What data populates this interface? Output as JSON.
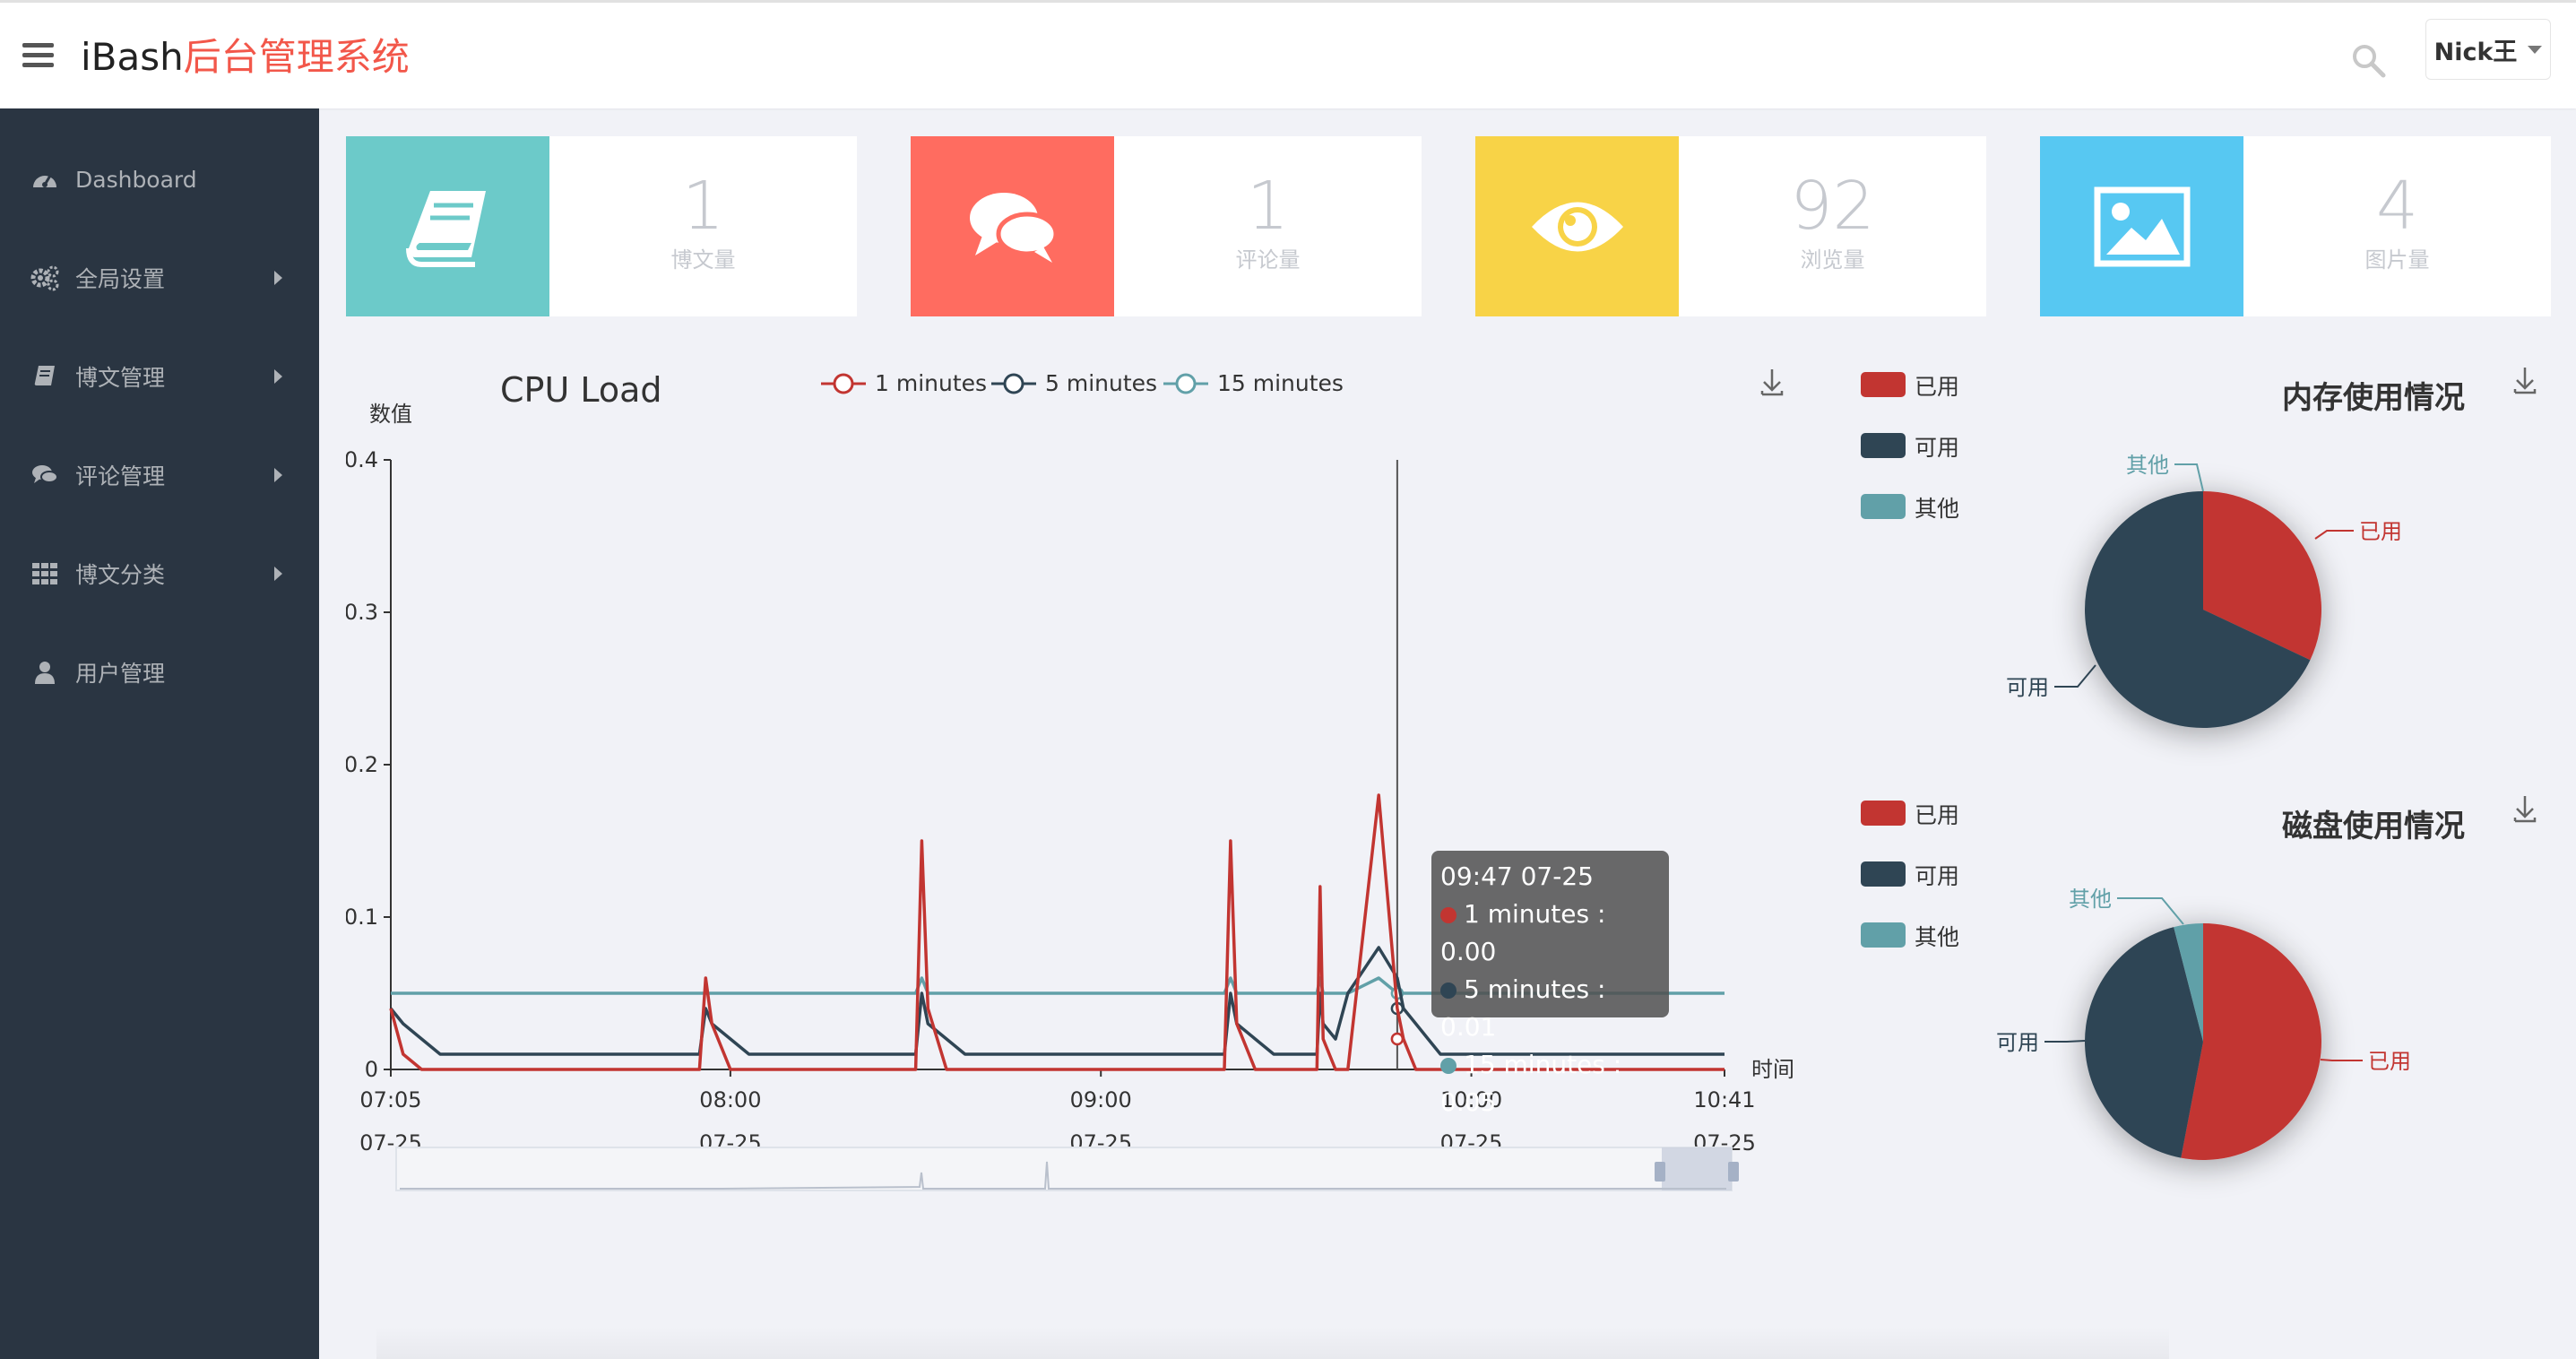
{
  "topbar": {
    "brand_prefix": "iBash",
    "brand_suffix": "后台管理系统",
    "user_name": "Nick王"
  },
  "sidebar": {
    "items": [
      {
        "label": "Dashboard",
        "icon": "dashboard-icon"
      },
      {
        "label": "全局设置",
        "icon": "gears-icon"
      },
      {
        "label": "博文管理",
        "icon": "book-icon"
      },
      {
        "label": "评论管理",
        "icon": "comments-icon"
      },
      {
        "label": "博文分类",
        "icon": "grid-icon"
      },
      {
        "label": "用户管理",
        "icon": "user-icon"
      }
    ]
  },
  "cards": [
    {
      "value": "1",
      "label": "博文量",
      "color": "#6ccac9",
      "icon": "book-icon"
    },
    {
      "value": "1",
      "label": "评论量",
      "color": "#ff6c60",
      "icon": "comments-icon"
    },
    {
      "value": "92",
      "label": "浏览量",
      "color": "#f8d347",
      "icon": "eye-icon"
    },
    {
      "value": "4",
      "label": "图片量",
      "color": "#57c8f2",
      "icon": "picture-icon"
    }
  ],
  "chart_data": [
    {
      "type": "line",
      "title": "CPU Load",
      "ylabel": "数值",
      "xlabel": "时间",
      "ylim": [
        0,
        0.4
      ],
      "yticks": [
        "0",
        "0.1",
        "0.2",
        "0.3",
        "0.4"
      ],
      "xticks": [
        {
          "time": "07:05",
          "date": "07-25"
        },
        {
          "time": "08:00",
          "date": "07-25"
        },
        {
          "time": "09:00",
          "date": "07-25"
        },
        {
          "time": "10:00",
          "date": "07-25"
        },
        {
          "time": "10:41",
          "date": "07-25"
        }
      ],
      "x_minutes": [
        0,
        2,
        5,
        8,
        30,
        50,
        51,
        52,
        55,
        58,
        75,
        85,
        86,
        87,
        90,
        93,
        120,
        135,
        136,
        137,
        140,
        143,
        150,
        150.5,
        151,
        153,
        155,
        160,
        163,
        164,
        166,
        168,
        170,
        172,
        180,
        216
      ],
      "series": [
        {
          "name": "1 minutes",
          "color": "#c23531",
          "values": [
            0.04,
            0.01,
            0,
            0,
            0,
            0,
            0.06,
            0.03,
            0,
            0,
            0,
            0,
            0.15,
            0.04,
            0,
            0,
            0,
            0,
            0.15,
            0.03,
            0,
            0,
            0,
            0.12,
            0.02,
            0,
            0,
            0.18,
            0.04,
            0.02,
            0,
            0,
            0,
            0,
            0,
            0
          ]
        },
        {
          "name": "5 minutes",
          "color": "#2f4554",
          "values": [
            0.04,
            0.03,
            0.02,
            0.01,
            0.01,
            0.01,
            0.04,
            0.03,
            0.02,
            0.01,
            0.01,
            0.01,
            0.05,
            0.03,
            0.02,
            0.01,
            0.01,
            0.01,
            0.05,
            0.03,
            0.02,
            0.01,
            0.01,
            0.05,
            0.03,
            0.02,
            0.05,
            0.08,
            0.06,
            0.04,
            0.03,
            0.02,
            0.01,
            0.01,
            0.01,
            0.01
          ]
        },
        {
          "name": "15 minutes",
          "color": "#61a0a8",
          "values": [
            0.05,
            0.05,
            0.05,
            0.05,
            0.05,
            0.05,
            0.05,
            0.05,
            0.05,
            0.05,
            0.05,
            0.05,
            0.06,
            0.05,
            0.05,
            0.05,
            0.05,
            0.05,
            0.06,
            0.05,
            0.05,
            0.05,
            0.05,
            0.06,
            0.05,
            0.05,
            0.05,
            0.06,
            0.05,
            0.05,
            0.05,
            0.05,
            0.05,
            0.05,
            0.05,
            0.05
          ]
        }
      ],
      "tooltip": {
        "header": "09:47 07-25",
        "rows": [
          "1 minutes : 0.00",
          "5 minutes : 0.01",
          "15 minutes : 0.05"
        ]
      }
    },
    {
      "type": "pie",
      "title": "内存使用情况",
      "legend": [
        "已用",
        "可用",
        "其他"
      ],
      "slices": [
        {
          "name": "已用",
          "value": 32,
          "color": "#c23531"
        },
        {
          "name": "可用",
          "value": 68,
          "color": "#2f4554"
        },
        {
          "name": "其他",
          "value": 0,
          "color": "#61a0a8"
        }
      ]
    },
    {
      "type": "pie",
      "title": "磁盘使用情况",
      "legend": [
        "已用",
        "可用",
        "其他"
      ],
      "slices": [
        {
          "name": "已用",
          "value": 53,
          "color": "#c23531"
        },
        {
          "name": "可用",
          "value": 43,
          "color": "#2f4554"
        },
        {
          "name": "其他",
          "value": 4,
          "color": "#61a0a8"
        }
      ]
    }
  ]
}
